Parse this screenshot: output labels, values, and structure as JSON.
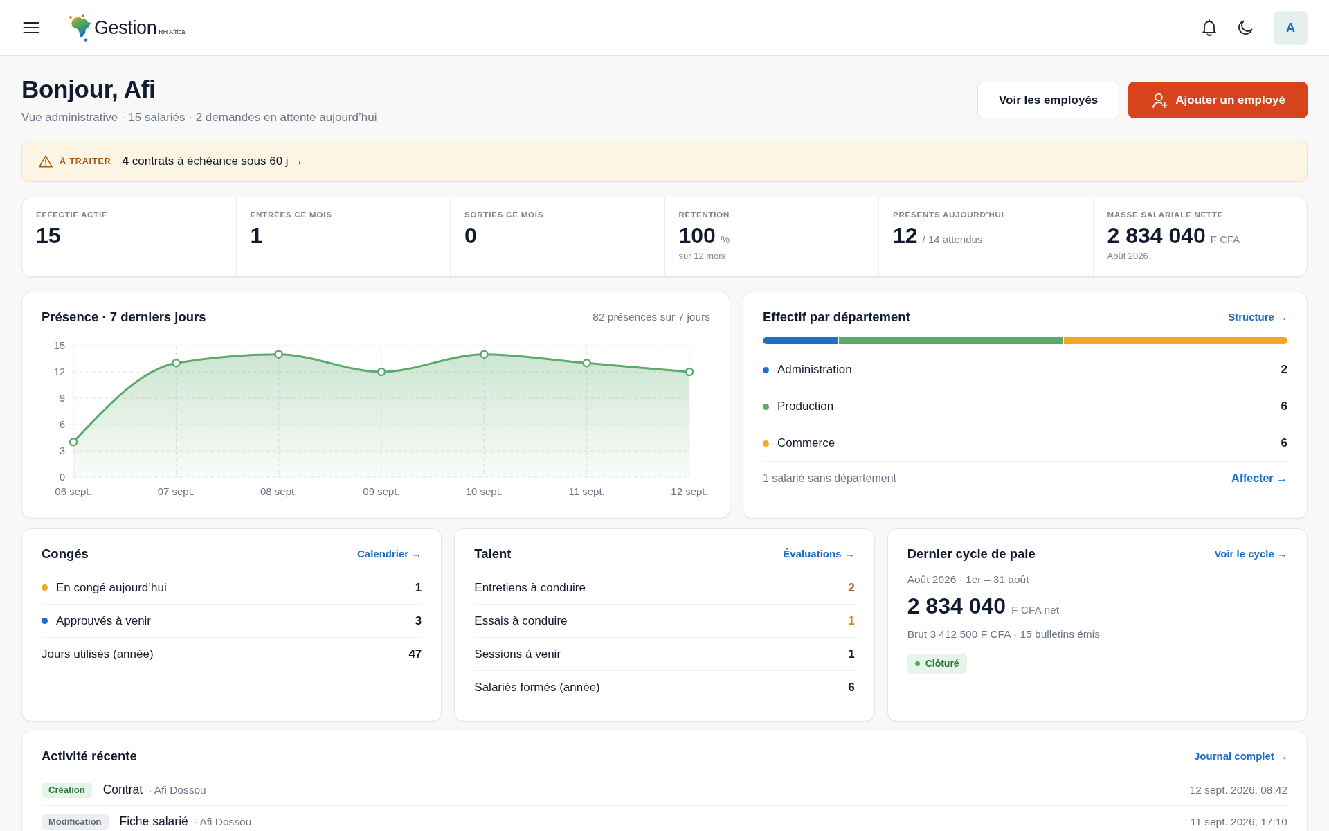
{
  "header": {
    "logo_title": "Gestion",
    "logo_subtitle": "RH Africa",
    "avatar": "A"
  },
  "greeting": {
    "title": "Bonjour, Afi",
    "subtitle": "Vue administrative · 15 salariés · 2 demandes en attente aujourd’hui"
  },
  "actions": [
    {
      "label": "Voir les employés",
      "kind": "secondary"
    },
    {
      "label": "Ajouter un employé",
      "kind": "primary"
    }
  ],
  "alert": {
    "label": "À TRAITER",
    "message": "**4** contrats à échéance sous 60 j →"
  },
  "kpis": [
    {
      "label": "EFFECTIF ACTIF",
      "value": "15"
    },
    {
      "label": "ENTRÉES CE MOIS",
      "value": "1"
    },
    {
      "label": "SORTIES CE MOIS",
      "value": "0"
    },
    {
      "label": "RÉTENTION",
      "value": "100",
      "unit": "%",
      "note": "sur 12 mois"
    },
    {
      "label": "PRÉSENTS AUJOURD’HUI",
      "value": "12",
      "unit": "/ 14 attendus"
    },
    {
      "label": "MASSE SALARIALE NETTE",
      "value": "2 834 040",
      "unit": "F CFA",
      "note": "Août 2026"
    }
  ],
  "presence": {
    "title": "Présence · 7 derniers jours",
    "summary": "82 présences sur 7 jours",
    "chart_data": {
      "type": "area",
      "categories": [
        "06 sept.",
        "07 sept.",
        "08 sept.",
        "09 sept.",
        "10 sept.",
        "11 sept.",
        "12 sept."
      ],
      "series": [
        {
          "color": "#5aab6a",
          "values": [
            4,
            13,
            14,
            12,
            14,
            13,
            12
          ]
        }
      ],
      "ylim": [
        0,
        15
      ],
      "yticks": [
        0,
        3,
        6,
        9,
        12,
        15
      ],
      "grid": true
    }
  },
  "departments": {
    "title": "Effectif par département",
    "link": "Structure →",
    "items": [
      {
        "name": "Administration",
        "count": "2",
        "color": "#1f6fc5"
      },
      {
        "name": "Production",
        "count": "6",
        "color": "#5aab6a"
      },
      {
        "name": "Commerce",
        "count": "6",
        "color": "#f5a623"
      }
    ],
    "footer": "1 salarié sans département",
    "footer_link": "Affecter →"
  },
  "leave": {
    "title": "Congés",
    "link": "Calendrier →",
    "items": [
      {
        "label": "En congé aujourd’hui",
        "value": "1",
        "color": "#f5a623"
      },
      {
        "label": "Approuvés à venir",
        "value": "3",
        "color": "#1f6fc5"
      },
      {
        "label": "Jours utilisés (année)",
        "value": "47"
      }
    ]
  },
  "talent": {
    "title": "Talent",
    "link": "Évaluations →",
    "items": [
      {
        "label": "Entretiens à conduire",
        "value": "2",
        "color": "#b4661c"
      },
      {
        "label": "Essais à conduire",
        "value": "1",
        "color": "#d48a1f"
      },
      {
        "label": "Sessions à venir",
        "value": "1"
      },
      {
        "label": "Salariés formés (année)",
        "value": "6"
      }
    ]
  },
  "payroll": {
    "title": "Dernier cycle de paie",
    "link": "Voir le cycle →",
    "period": "Août 2026 · 1er – 31 août",
    "amount": "2 834 040",
    "unit": "F CFA net",
    "detail": "Brut 3 412 500 F CFA · 15 bulletins émis",
    "status": {
      "label": "Clôturé",
      "kind": "closed"
    }
  },
  "activity": {
    "title": "Activité récente",
    "link": "Journal complet →",
    "items": [
      {
        "tag": "Création",
        "kind": "create",
        "entity": "Contrat",
        "author": "· Afi Dossou",
        "date": "12 sept. 2026, 08:42"
      },
      {
        "tag": "Modification",
        "kind": "update",
        "entity": "Fiche salarié",
        "author": "· Afi Dossou",
        "date": "11 sept. 2026, 17:10"
      }
    ]
  }
}
